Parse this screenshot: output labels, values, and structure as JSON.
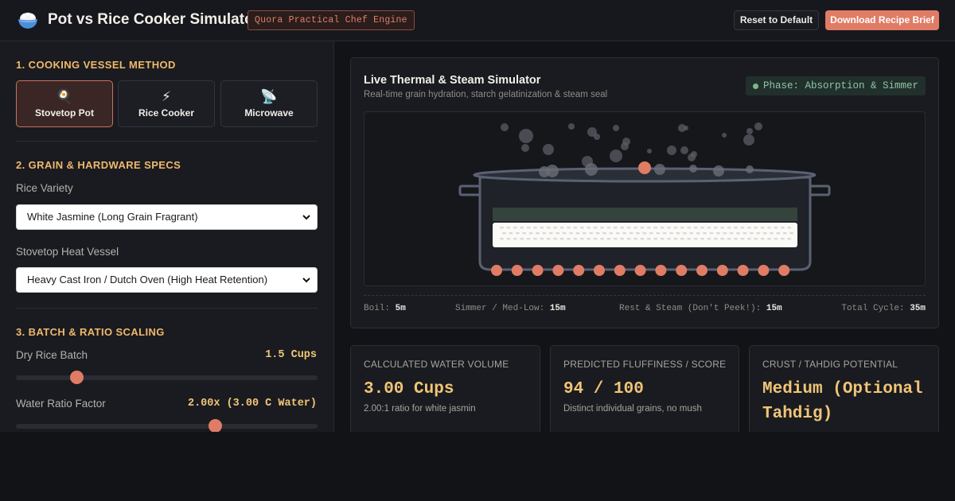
{
  "header": {
    "title": "Pot vs Rice Cooker Simulator",
    "badge": "Quora Practical Chef Engine",
    "reset_label": "Reset to Default",
    "download_label": "Download Recipe Brief"
  },
  "sidebar": {
    "vessel_section": "1. COOKING VESSEL METHOD",
    "vessels": [
      {
        "icon": "🍳",
        "label": "Stovetop Pot",
        "active": true
      },
      {
        "icon": "⚡",
        "label": "Rice Cooker",
        "active": false
      },
      {
        "icon": "📡",
        "label": "Microwave",
        "active": false
      }
    ],
    "specs_section": "2. GRAIN & HARDWARE SPECS",
    "rice_variety_label": "Rice Variety",
    "rice_variety_value": "White Jasmine (Long Grain Fragrant)",
    "heat_vessel_label": "Stovetop Heat Vessel",
    "heat_vessel_value": "Heavy Cast Iron / Dutch Oven (High Heat Retention)",
    "batch_section": "3. BATCH & RATIO SCALING",
    "dry_batch_label": "Dry Rice Batch",
    "dry_batch_value": "1.5 Cups",
    "dry_batch_level": 0.2,
    "water_ratio_label": "Water Ratio Factor",
    "water_ratio_value": "2.00x (3.00 C Water)",
    "water_ratio_level": 0.66
  },
  "simulator": {
    "title": "Live Thermal & Steam Simulator",
    "subtitle": "Real-time grain hydration, starch gelatinization & steam seal",
    "phase": "Phase: Absorption & Simmer",
    "timeline": [
      {
        "label": "Boil:",
        "value": "5m"
      },
      {
        "label": "Simmer / Med-Low:",
        "value": "15m"
      },
      {
        "label": "Rest & Steam (Don't Peek!):",
        "value": "15m"
      },
      {
        "label": "Total Cycle:",
        "value": "35m"
      }
    ]
  },
  "metrics": [
    {
      "label": "CALCULATED WATER VOLUME",
      "value": "3.00 Cups",
      "note": "2.00:1 ratio for white jasmin"
    },
    {
      "label": "PREDICTED FLUFFINESS / SCORE",
      "value": "94 / 100",
      "note": "Distinct individual grains, no mush"
    },
    {
      "label": "CRUST / TAHDIG POTENTIAL",
      "value": "Medium (Optional Tahdig)",
      "note": ""
    }
  ],
  "colors": {
    "accent": "#e07c65",
    "highlight": "#f0c577",
    "section": "#f0b96b",
    "phase_green": "#8fc5a6"
  }
}
